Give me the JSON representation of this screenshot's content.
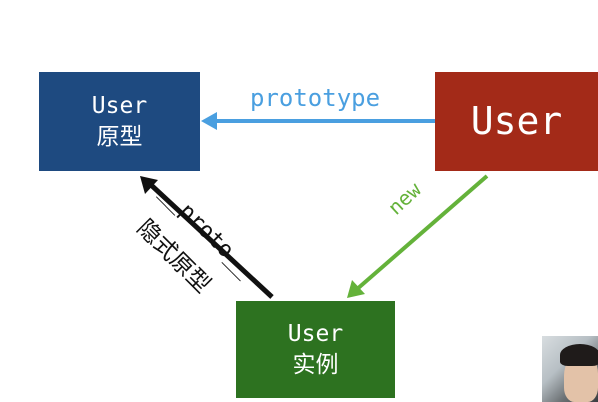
{
  "nodes": {
    "prototype": {
      "line1": "User",
      "line2": "原型"
    },
    "constructor": {
      "line1": "User"
    },
    "instance": {
      "line1": "User",
      "line2": "实例"
    }
  },
  "edges": {
    "prototype_label": "prototype",
    "new_label": "new",
    "proto_label": "__proto__",
    "implicit_label": "隐式原型"
  },
  "colors": {
    "prototype_box": "#1e4a80",
    "constructor_box": "#a32a18",
    "instance_box": "#2d7220",
    "prototype_arrow": "#4a9fe0",
    "new_arrow": "#64b23a",
    "proto_arrow": "#111111"
  }
}
